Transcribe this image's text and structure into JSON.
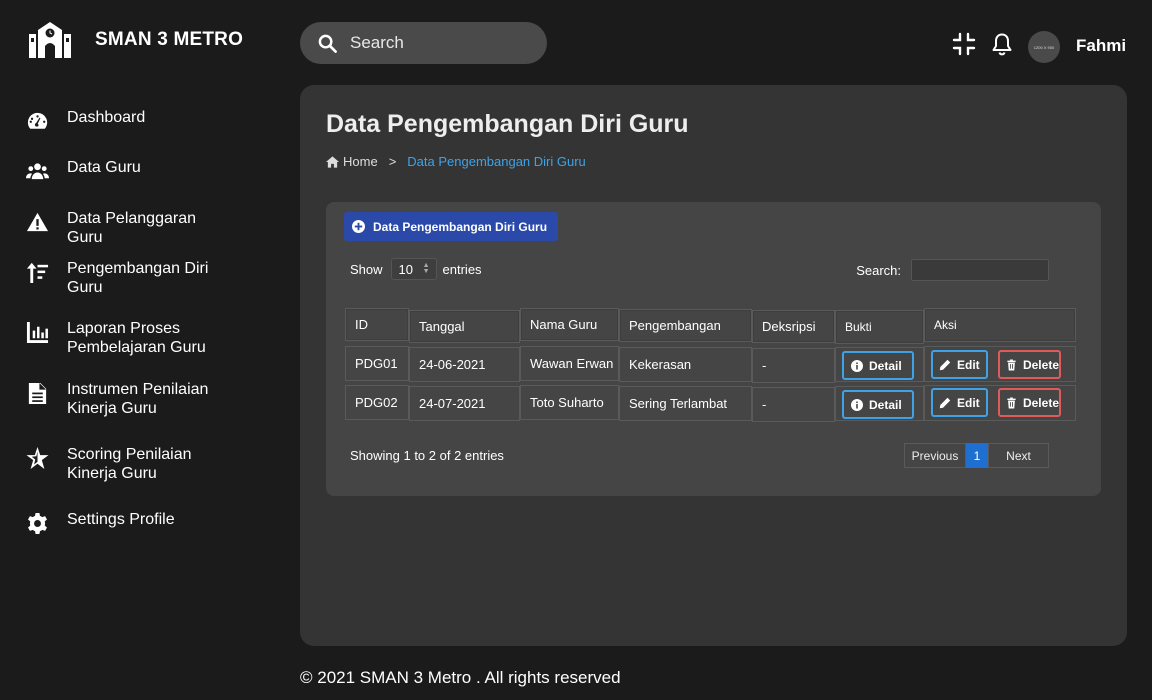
{
  "brand": {
    "name": "SMAN 3 METRO"
  },
  "sidebar": {
    "items": [
      {
        "label": "Dashboard",
        "icon": "gauge-icon"
      },
      {
        "label": "Data Guru",
        "icon": "users-icon"
      },
      {
        "label": "Data Pelanggaran Guru",
        "icon": "warning-icon"
      },
      {
        "label": "Pengembangan Diri Guru",
        "icon": "sort-up-icon"
      },
      {
        "label": "Laporan Proses Pembelajaran Guru",
        "icon": "bar-chart-icon"
      },
      {
        "label": "Instrumen Penilaian Kinerja Guru",
        "icon": "document-icon"
      },
      {
        "label": "Scoring Penilaian Kinerja Guru",
        "icon": "star-icon"
      },
      {
        "label": "Settings Profile",
        "icon": "gear-icon"
      }
    ]
  },
  "topbar": {
    "search_placeholder": "Search",
    "avatar_text": "1200 X 900",
    "username": "Fahmi"
  },
  "page": {
    "title": "Data Pengembangan Diri Guru",
    "breadcrumb": {
      "home": "Home",
      "separator": ">",
      "current": "Data Pengembangan Diri Guru"
    }
  },
  "card": {
    "add_button": "Data Pengembangan Diri Guru",
    "show_label": "Show",
    "page_size": "10",
    "entries_label": "entries",
    "search_label": "Search:",
    "columns": [
      "ID",
      "Tanggal",
      "Nama Guru",
      "Pengembangan",
      "Deksripsi",
      "Bukti",
      "Aksi"
    ],
    "rows": [
      {
        "id": "PDG01",
        "tanggal": "24-06-2021",
        "nama": "Wawan Erwan",
        "pengembangan": "Kekerasan",
        "deskripsi": "-"
      },
      {
        "id": "PDG02",
        "tanggal": "24-07-2021",
        "nama": "Toto Suharto",
        "pengembangan": "Sering Terlambat",
        "deskripsi": "-"
      }
    ],
    "detail_label": "Detail",
    "edit_label": "Edit",
    "delete_label": "Delete",
    "info": "Showing 1 to 2 of 2 entries",
    "pager": {
      "previous": "Previous",
      "current": "1",
      "next": "Next"
    }
  },
  "footer": {
    "text": "© 2021 SMAN 3 Metro . All rights reserved"
  },
  "colors": {
    "accent": "#3ea3e6",
    "primary_button": "#2a49a8",
    "danger": "#e05a5a",
    "page_active": "#1e6fd0"
  }
}
